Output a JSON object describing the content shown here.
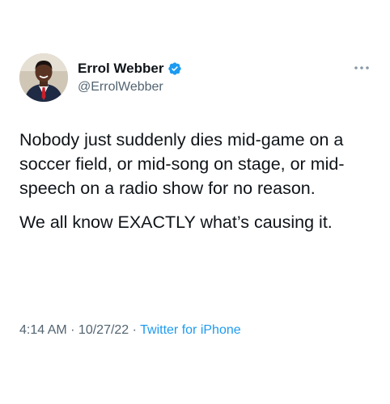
{
  "tweet": {
    "author": {
      "display_name": "Errol Webber",
      "handle": "@ErrolWebber",
      "verified_icon": "verified-badge-icon",
      "avatar_icon": "profile-photo"
    },
    "paragraphs": [
      "Nobody just suddenly dies mid-game on a soccer field, or mid-song on stage, or mid-speech on a radio show for no reason.",
      "We all know EXACTLY what’s causing it."
    ],
    "time": "4:14 AM",
    "separator": " · ",
    "date": "10/27/22",
    "source": "Twitter for iPhone",
    "more_icon": "more-options-icon"
  },
  "colors": {
    "text": "#0f1419",
    "secondary": "#536471",
    "accent": "#1d9bf0",
    "background": "#ffffff"
  }
}
